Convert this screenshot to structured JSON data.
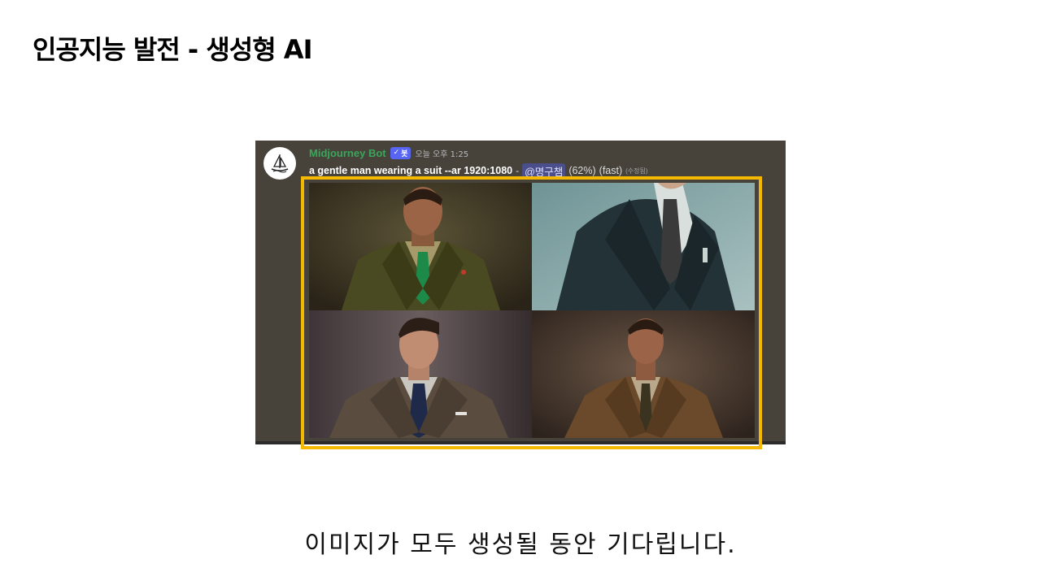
{
  "slide": {
    "title": "인공지능 발전 - 생성형 AI",
    "caption": "이미지가 모두 생성될 동안 기다립니다."
  },
  "message": {
    "author": "Midjourney Bot",
    "badge": "봇",
    "badge_check": "✓",
    "timestamp": "오늘 오후 1:25",
    "prompt": "a gentle man wearing a suit --ar 1920:1080",
    "separator": "-",
    "mention": "@명구챔",
    "progress": "(62%)",
    "mode": "(fast)",
    "edited": "(수정됨)"
  },
  "images": [
    {
      "alt": "man in olive suit with green tie",
      "icon": "generated-image"
    },
    {
      "alt": "dark suit torso on teal background",
      "icon": "generated-image"
    },
    {
      "alt": "man in grey suit with navy tie",
      "icon": "generated-image"
    },
    {
      "alt": "man in brown suit",
      "icon": "generated-image"
    }
  ],
  "colors": {
    "highlight": "#f5b800",
    "author": "#3ba55c",
    "badge": "#5865f2",
    "discord_bg": "#47423a"
  }
}
